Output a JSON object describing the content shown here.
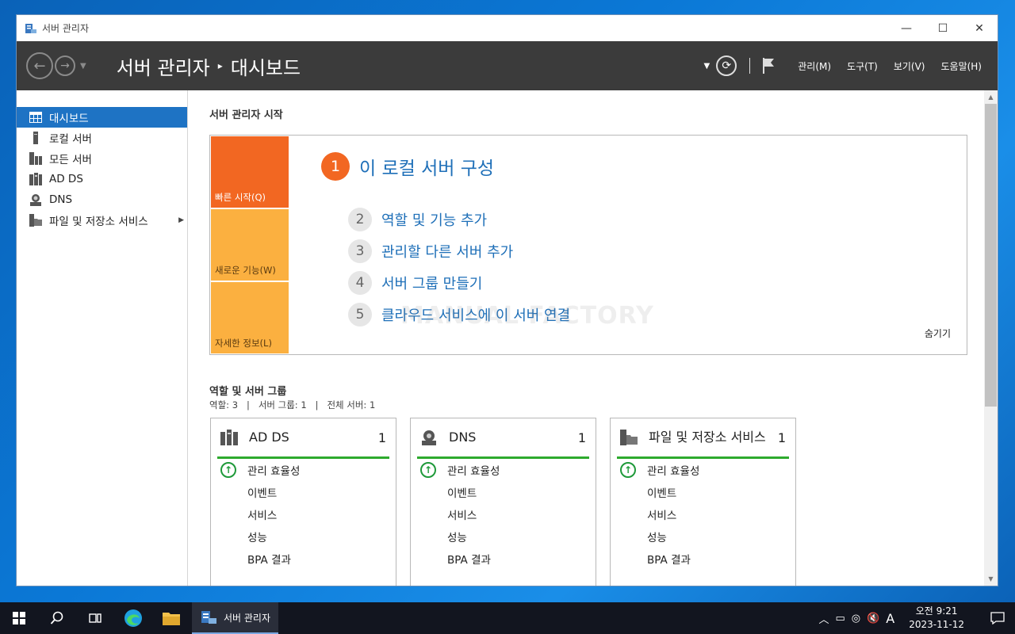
{
  "window": {
    "title": "서버 관리자",
    "minimize": "—",
    "maximize": "☐",
    "close": "✕"
  },
  "header": {
    "breadcrumb_root": "서버 관리자",
    "breadcrumb_sep": "▸",
    "breadcrumb_current": "대시보드",
    "menu": [
      "관리(M)",
      "도구(T)",
      "보기(V)",
      "도움말(H)"
    ]
  },
  "sidebar": {
    "items": [
      {
        "label": "대시보드",
        "icon": "dashboard-icon",
        "active": true
      },
      {
        "label": "로컬 서버",
        "icon": "local-server-icon"
      },
      {
        "label": "모든 서버",
        "icon": "all-servers-icon"
      },
      {
        "label": "AD DS",
        "icon": "adds-icon"
      },
      {
        "label": "DNS",
        "icon": "dns-icon"
      },
      {
        "label": "파일 및 저장소 서비스",
        "icon": "file-storage-icon",
        "has_arrow": true
      }
    ]
  },
  "welcome": {
    "section_title": "서버 관리자 시작",
    "tiles": [
      "빠른 시작(Q)",
      "새로운 기능(W)",
      "자세한 정보(L)"
    ],
    "step1": {
      "num": "1",
      "text": "이 로컬 서버 구성"
    },
    "steps": [
      {
        "num": "2",
        "text": "역할 및 기능 추가"
      },
      {
        "num": "3",
        "text": "관리할 다른 서버 추가"
      },
      {
        "num": "4",
        "text": "서버 그룹 만들기"
      },
      {
        "num": "5",
        "text": "클라우드 서비스에 이 서버 연결"
      }
    ],
    "watermark": "MANUAL FACTORY",
    "hide": "숨기기"
  },
  "roles": {
    "title": "역할 및 서버 그룹",
    "summary": "역할: 3   |   서버 그룹: 1   |   전체 서버: 1",
    "cards": [
      {
        "name": "AD DS",
        "count": "1",
        "rows": [
          "관리 효율성",
          "이벤트",
          "서비스",
          "성능",
          "BPA 결과"
        ]
      },
      {
        "name": "DNS",
        "count": "1",
        "rows": [
          "관리 효율성",
          "이벤트",
          "서비스",
          "성능",
          "BPA 결과"
        ]
      },
      {
        "name": "파일 및 저장소 서비스",
        "count": "1",
        "rows": [
          "관리 효율성",
          "이벤트",
          "서비스",
          "성능",
          "BPA 결과"
        ]
      }
    ]
  },
  "taskbar": {
    "app_label": "서버 관리자",
    "ime": "A",
    "time": "오전 9:21",
    "date": "2023-11-12"
  }
}
